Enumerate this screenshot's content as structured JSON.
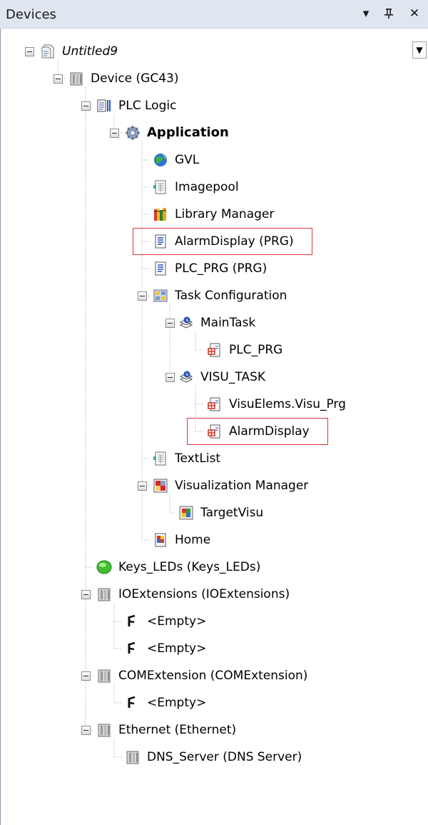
{
  "panel": {
    "title": "Devices",
    "buttons": [
      {
        "name": "dropdown",
        "glyph": "▾"
      },
      {
        "name": "pin",
        "glyph": "ᴘ"
      },
      {
        "name": "close",
        "glyph": "✕"
      }
    ]
  },
  "tree": {
    "nodes": [
      {
        "id": "n0",
        "label": "Untitled9",
        "icon": "project-icon",
        "style": "italic",
        "expander": true
      },
      {
        "id": "n1",
        "label": "Device (GC43)",
        "icon": "device-icon",
        "expander": true
      },
      {
        "id": "n2",
        "label": "PLC Logic",
        "icon": "plc-logic-icon",
        "expander": true
      },
      {
        "id": "n3",
        "label": "Application",
        "icon": "application-gear-icon",
        "style": "bold",
        "expander": true
      },
      {
        "id": "n4",
        "label": "GVL",
        "icon": "globe-icon",
        "expander": false
      },
      {
        "id": "n5",
        "label": "Imagepool",
        "icon": "pool-icon",
        "expander": false
      },
      {
        "id": "n6",
        "label": "Library Manager",
        "icon": "library-books-icon",
        "expander": false
      },
      {
        "id": "n7",
        "label": "AlarmDisplay (PRG)",
        "icon": "program-icon",
        "expander": false,
        "highlighted": true
      },
      {
        "id": "n8",
        "label": "PLC_PRG (PRG)",
        "icon": "program-icon",
        "expander": false
      },
      {
        "id": "n9",
        "label": "Task Configuration",
        "icon": "task-config-icon",
        "expander": true
      },
      {
        "id": "n10",
        "label": "MainTask",
        "icon": "task-icon",
        "expander": true
      },
      {
        "id": "n11",
        "label": "PLC_PRG",
        "icon": "program-call-icon",
        "expander": false
      },
      {
        "id": "n12",
        "label": "VISU_TASK",
        "icon": "task-icon",
        "expander": true
      },
      {
        "id": "n13",
        "label": "VisuElems.Visu_Prg",
        "icon": "program-call-icon",
        "expander": false
      },
      {
        "id": "n14",
        "label": "AlarmDisplay",
        "icon": "program-call-icon",
        "expander": false,
        "highlighted": true
      },
      {
        "id": "n15",
        "label": "TextList",
        "icon": "pool-icon",
        "expander": false
      },
      {
        "id": "n16",
        "label": "Visualization Manager",
        "icon": "visu-manager-icon",
        "expander": true
      },
      {
        "id": "n17",
        "label": "TargetVisu",
        "icon": "target-visu-icon",
        "expander": false
      },
      {
        "id": "n18",
        "label": "Home",
        "icon": "visualization-icon",
        "expander": false
      },
      {
        "id": "n19",
        "label": "Keys_LEDs (Keys_LEDs)",
        "icon": "led-icon",
        "expander": false
      },
      {
        "id": "n20",
        "label": "IOExtensions (IOExtensions)",
        "icon": "device-icon",
        "expander": true
      },
      {
        "id": "n21",
        "label": "<Empty>",
        "icon": "empty-slot-icon",
        "expander": false
      },
      {
        "id": "n22",
        "label": "<Empty>",
        "icon": "empty-slot-icon",
        "expander": false
      },
      {
        "id": "n23",
        "label": "COMExtension (COMExtension)",
        "icon": "device-icon",
        "expander": true
      },
      {
        "id": "n24",
        "label": "<Empty>",
        "icon": "empty-slot-icon",
        "expander": false
      },
      {
        "id": "n25",
        "label": "Ethernet (Ethernet)",
        "icon": "device-icon",
        "expander": true
      },
      {
        "id": "n26",
        "label": "DNS_Server (DNS Server)",
        "icon": "device-icon",
        "expander": false
      }
    ]
  },
  "colors": {
    "titlebar": "#dfe6ef",
    "highlight": "#e0343a",
    "treeLine": "#a0a0a0"
  }
}
